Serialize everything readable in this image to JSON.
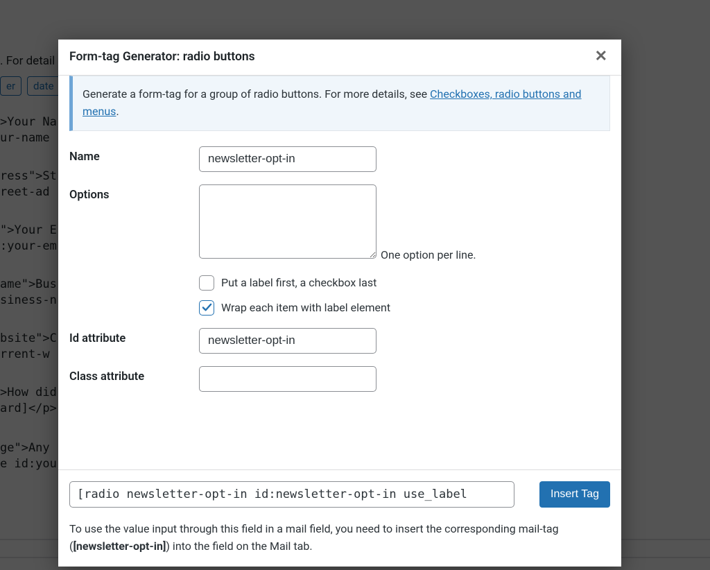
{
  "background": {
    "detailsText": ". For detail",
    "btnEr": "er",
    "btnDate": "date",
    "code1a": ">Your Na",
    "code1b": "ur-name",
    "code2a": "ress\">St",
    "code2b": "reet-ad",
    "code3a": "\">Your E",
    "code3b": ":your-em",
    "code4a": "ame\">Bus",
    "code4b": "siness-n",
    "code5a": "bsite\">C",
    "code5b": "rrent-w",
    "code6a": ">How did",
    "code6b": "ard]</p>",
    "code7a": "ge\">Any ",
    "code7b": "e id:you"
  },
  "modal": {
    "title": "Form-tag Generator: radio buttons",
    "info": {
      "prefix": "Generate a form-tag for a group of radio buttons. For more details, see ",
      "linkText": "Checkboxes, radio buttons and menus",
      "suffix": "."
    },
    "fields": {
      "nameLabel": "Name",
      "nameValue": "newsletter-opt-in",
      "optionsLabel": "Options",
      "optionsHint": "One option per line.",
      "cbLabelFirst": "Put a label first, a checkbox last",
      "cbWrapLabel": "Wrap each item with label element",
      "idLabel": "Id attribute",
      "idValue": "newsletter-opt-in",
      "classLabel": "Class attribute",
      "classValue": ""
    },
    "footer": {
      "tagOutput": "[radio newsletter-opt-in id:newsletter-opt-in use_label",
      "insertBtn": "Insert Tag",
      "helpPrefix": "To use the value input through this field in a mail field, you need to insert the corresponding mail-tag (",
      "helpTag": "[newsletter-opt-in]",
      "helpSuffix": ") into the field on the Mail tab."
    }
  }
}
